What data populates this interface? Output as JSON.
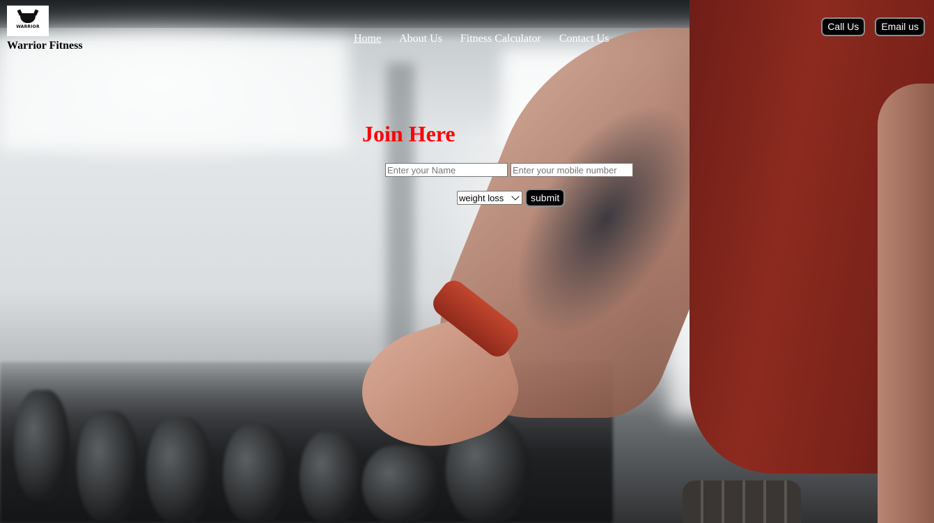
{
  "brand": {
    "logo_text": "WARRIOR",
    "name": "Warrior Fitness"
  },
  "nav": {
    "items": [
      "Home",
      "About Us",
      "Fitness Calculator",
      "Contact Us"
    ],
    "active": "Home"
  },
  "contact": {
    "call_label": "Call Us",
    "email_label": "Email us"
  },
  "join": {
    "title": "Join Here",
    "name_placeholder": "Enter your Name",
    "mobile_placeholder": "Enter your mobile number",
    "goal_selected": "weight loss",
    "submit_label": "submit"
  },
  "colors": {
    "title_red": "#ff0000",
    "button_bg": "#000000",
    "button_border": "#8e8e8e"
  }
}
